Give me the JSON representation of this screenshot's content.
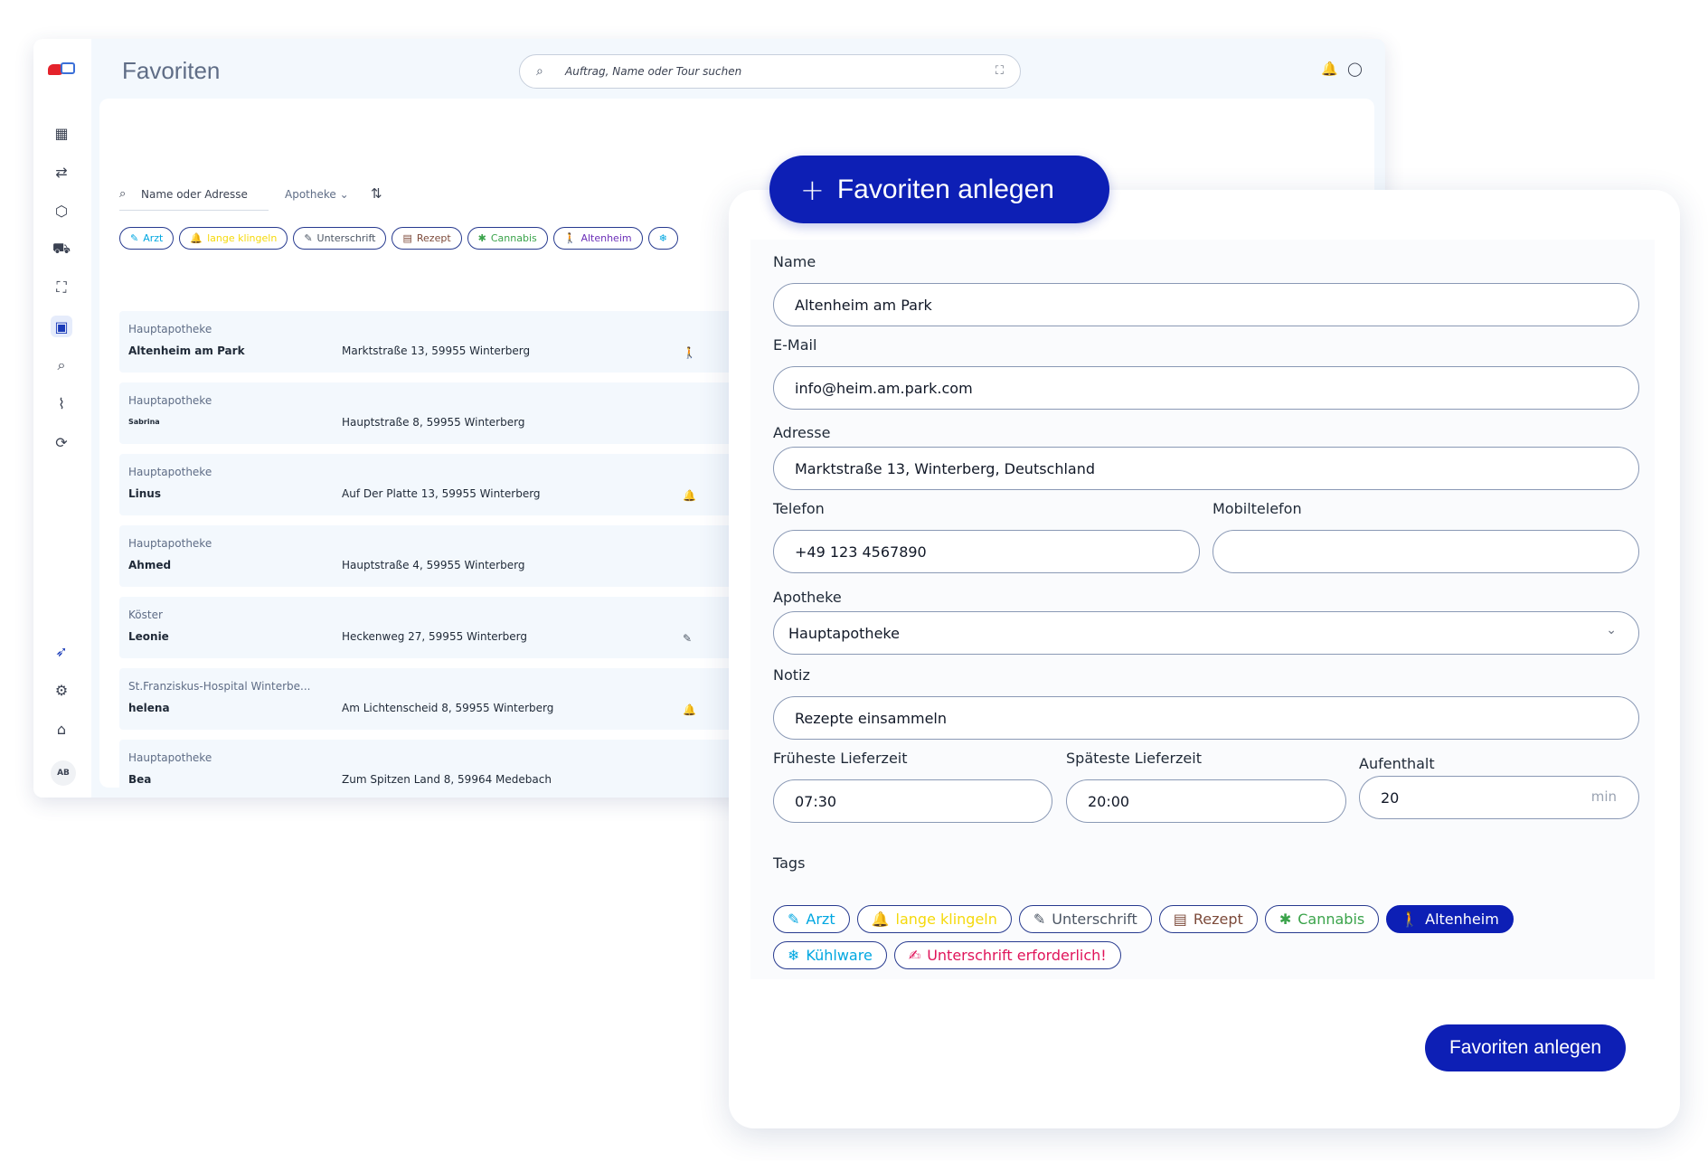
{
  "app": {
    "page_title": "Favoriten"
  },
  "search": {
    "placeholder": "Auftrag, Name oder Tour suchen"
  },
  "sidebar": {
    "icons": [
      "dashboard-icon",
      "routes-icon",
      "package-icon",
      "delivery-truck-icon",
      "scan-icon",
      "contacts-icon",
      "clipboard-search-icon",
      "analytics-icon",
      "sync-icon",
      "rocket-icon",
      "settings-icon",
      "store-icon"
    ],
    "avatar": "AB"
  },
  "list": {
    "filter_placeholder": "Name oder Adresse",
    "pharmacy_filter": "Apotheke",
    "tags": [
      {
        "label": "Arzt",
        "icon": "pencil-icon",
        "color": "#00a7e1"
      },
      {
        "label": "lange klingeln",
        "icon": "bell-icon",
        "color": "#f5d90a"
      },
      {
        "label": "Unterschrift",
        "icon": "pen-icon",
        "color": "#4b5563"
      },
      {
        "label": "Rezept",
        "icon": "receipt-icon",
        "color": "#7c4a3a"
      },
      {
        "label": "Cannabis",
        "icon": "leaf-icon",
        "color": "#3aa34a"
      },
      {
        "label": "Altenheim",
        "icon": "elderly-icon",
        "color": "#6b2fb8"
      },
      {
        "label": "",
        "icon": "snowflake-icon",
        "color": "#00a7e1"
      }
    ],
    "rows": [
      {
        "category": "Hauptapotheke",
        "name": "Altenheim am Park",
        "address": "Marktstraße 13, 59955 Winterberg",
        "tag_icon": "elderly-icon",
        "tag_glyph": "🚶",
        "tag_color": "#6b2fb8"
      },
      {
        "category": "Hauptapotheke",
        "name": "Sabrina",
        "address": "Hauptstraße 8, 59955 Winterberg",
        "tag_icon": "",
        "tag_glyph": "",
        "tag_color": ""
      },
      {
        "category": "Hauptapotheke",
        "name": "Linus",
        "address": "Auf Der Platte 13, 59955 Winterberg",
        "tag_icon": "bell-icon",
        "tag_glyph": "🔔",
        "tag_color": "#f5d90a"
      },
      {
        "category": "Hauptapotheke",
        "name": "Ahmed",
        "address": "Hauptstraße 4, 59955 Winterberg",
        "tag_icon": "",
        "tag_glyph": "",
        "tag_color": ""
      },
      {
        "category": "Köster",
        "name": "Leonie",
        "address": "Heckenweg 27, 59955 Winterberg",
        "tag_icon": "pen-icon",
        "tag_glyph": "✎",
        "tag_color": "#4b5563"
      },
      {
        "category": "St.Franziskus-Hospital Winterbe...",
        "name": "helena",
        "address": "Am Lichtenscheid 8, 59955 Winterberg",
        "tag_icon": "bell-icon",
        "tag_glyph": "🔔",
        "tag_color": "#f5d90a"
      },
      {
        "category": "Hauptapotheke",
        "name": "Bea",
        "address": "Zum Spitzen Land 8, 59964 Medebach",
        "tag_icon": "",
        "tag_glyph": "",
        "tag_color": ""
      }
    ]
  },
  "form": {
    "header_button": "Favoriten anlegen",
    "name_label": "Name",
    "name_value": "Altenheim am Park",
    "email_label": "E-Mail",
    "email_value": "info@heim.am.park.com",
    "address_label": "Adresse",
    "address_value": "Marktstraße 13, Winterberg, Deutschland",
    "phone_label": "Telefon",
    "phone_value": "+49 123 4567890",
    "mobile_label": "Mobiltelefon",
    "mobile_value": "",
    "pharmacy_label": "Apotheke",
    "pharmacy_value": "Hauptapotheke",
    "note_label": "Notiz",
    "note_value": "Rezepte einsammeln",
    "earliest_label": "Früheste Lieferzeit",
    "earliest_value": "07:30",
    "latest_label": "Späteste Lieferzeit",
    "latest_value": "20:00",
    "stay_label": "Aufenthalt",
    "stay_value": "20",
    "stay_unit": "min",
    "tags_label": "Tags",
    "tags": [
      {
        "label": "Arzt",
        "icon": "pencil-icon",
        "glyph": "✎",
        "color": "#00a7e1",
        "selected": false
      },
      {
        "label": "lange klingeln",
        "icon": "bell-icon",
        "glyph": "🔔",
        "color": "#f5d90a",
        "selected": false
      },
      {
        "label": "Unterschrift",
        "icon": "pen-icon",
        "glyph": "✎",
        "color": "#4b5563",
        "selected": false
      },
      {
        "label": "Rezept",
        "icon": "receipt-icon",
        "glyph": "▤",
        "color": "#7c4a3a",
        "selected": false
      },
      {
        "label": "Cannabis",
        "icon": "leaf-icon",
        "glyph": "✱",
        "color": "#3aa34a",
        "selected": false
      },
      {
        "label": "Altenheim",
        "icon": "elderly-icon",
        "glyph": "🚶",
        "color": "#6b2fb8",
        "selected": true
      },
      {
        "label": "Kühlware",
        "icon": "snowflake-icon",
        "glyph": "❄",
        "color": "#00a7e1",
        "selected": false
      },
      {
        "label": "Unterschrift erforderlich!",
        "icon": "signature-icon",
        "glyph": "✍",
        "color": "#e0145a",
        "selected": false
      }
    ],
    "submit_button": "Favoriten anlegen"
  }
}
